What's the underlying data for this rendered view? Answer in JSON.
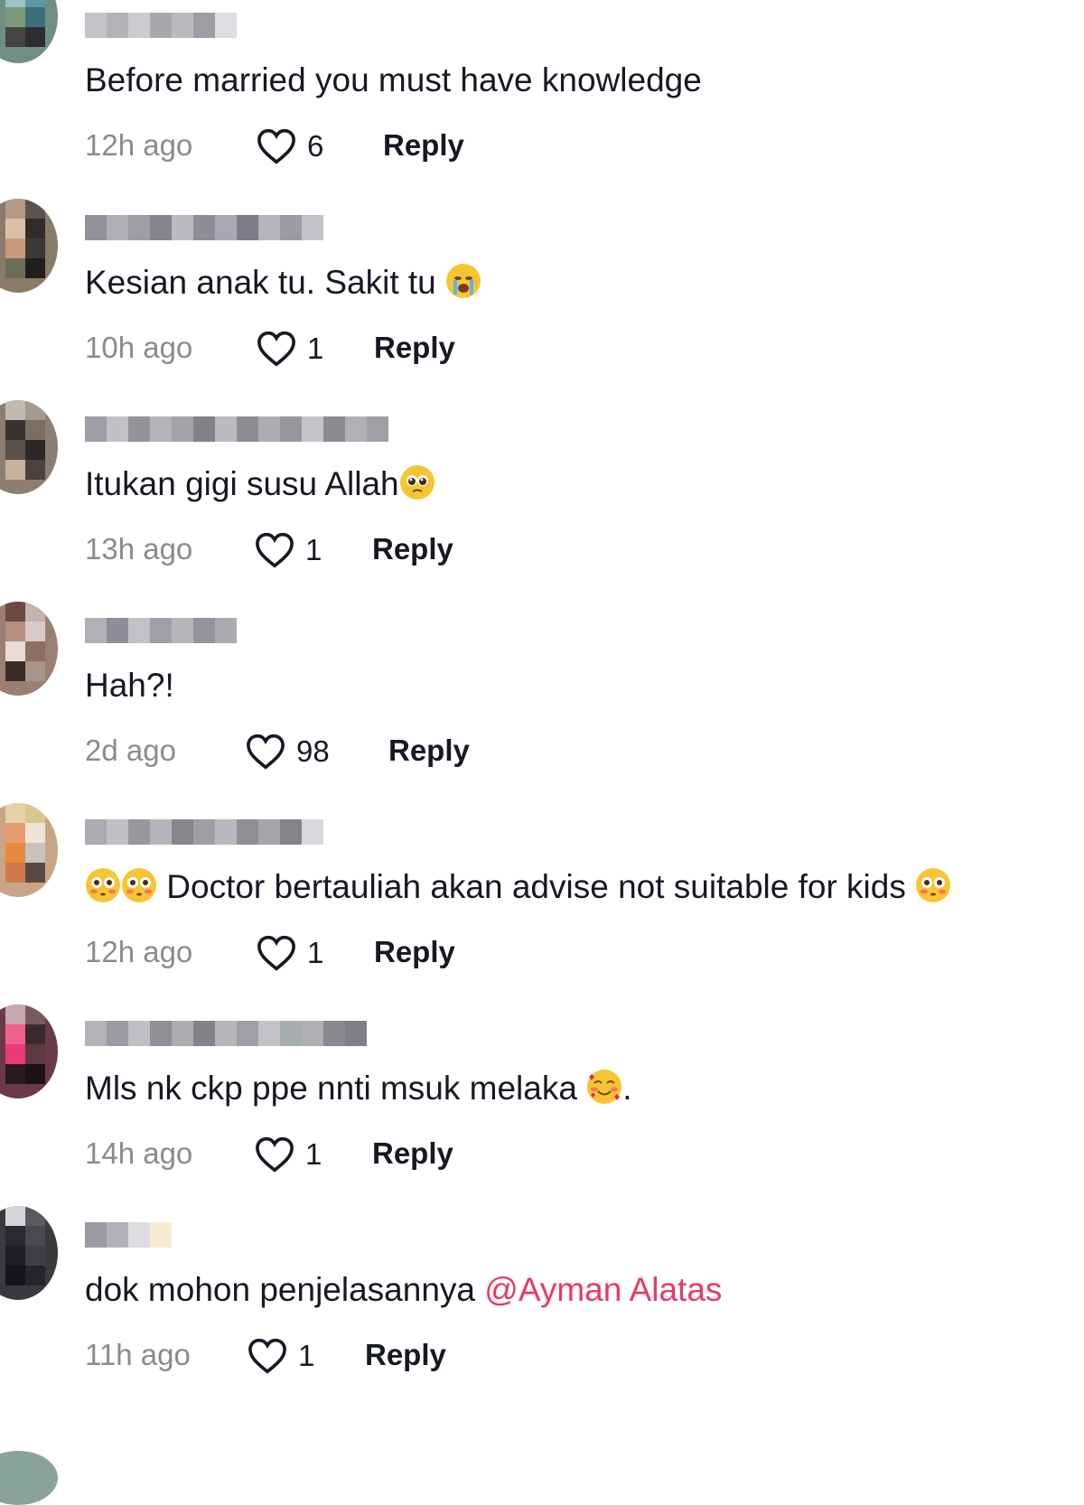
{
  "colors": {
    "text": "#161823",
    "muted": "#8a8b91",
    "mention": "#e83a66"
  },
  "comments": [
    {
      "text": "Before married you must have knowledge",
      "time": "12h ago",
      "likes": "6",
      "reply": "Reply",
      "avatar_icon": "avatar-blurred"
    },
    {
      "text": "Kesian anak tu. Sakit tu",
      "emoji_after": "loudly-crying-face",
      "time": "10h ago",
      "likes": "1",
      "reply": "Reply",
      "avatar_icon": "avatar-blurred"
    },
    {
      "text": "Itukan gigi susu Allah",
      "emoji_after": "pleading-face",
      "time": "13h ago",
      "likes": "1",
      "reply": "Reply",
      "avatar_icon": "avatar-blurred"
    },
    {
      "text": "Hah?!",
      "time": "2d ago",
      "likes": "98",
      "reply": "Reply",
      "avatar_icon": "avatar-blurred"
    },
    {
      "text": "Doctor bertauliah akan advise not suitable for kids",
      "emoji_before": "flushed-face",
      "emoji_after": "flushed-face",
      "time": "12h ago",
      "likes": "1",
      "reply": "Reply",
      "avatar_icon": "avatar-blurred"
    },
    {
      "text": "Mls nk ckp ppe nnti msuk melaka",
      "emoji_after": "smiling-face-with-hearts",
      "trailing": ".",
      "time": "14h ago",
      "likes": "1",
      "reply": "Reply",
      "avatar_icon": "avatar-blurred"
    },
    {
      "text": "dok mohon penjelasannya",
      "mention": "@Ayman Alatas",
      "time": "11h ago",
      "likes": "1",
      "reply": "Reply",
      "avatar_icon": "avatar-blurred"
    }
  ]
}
